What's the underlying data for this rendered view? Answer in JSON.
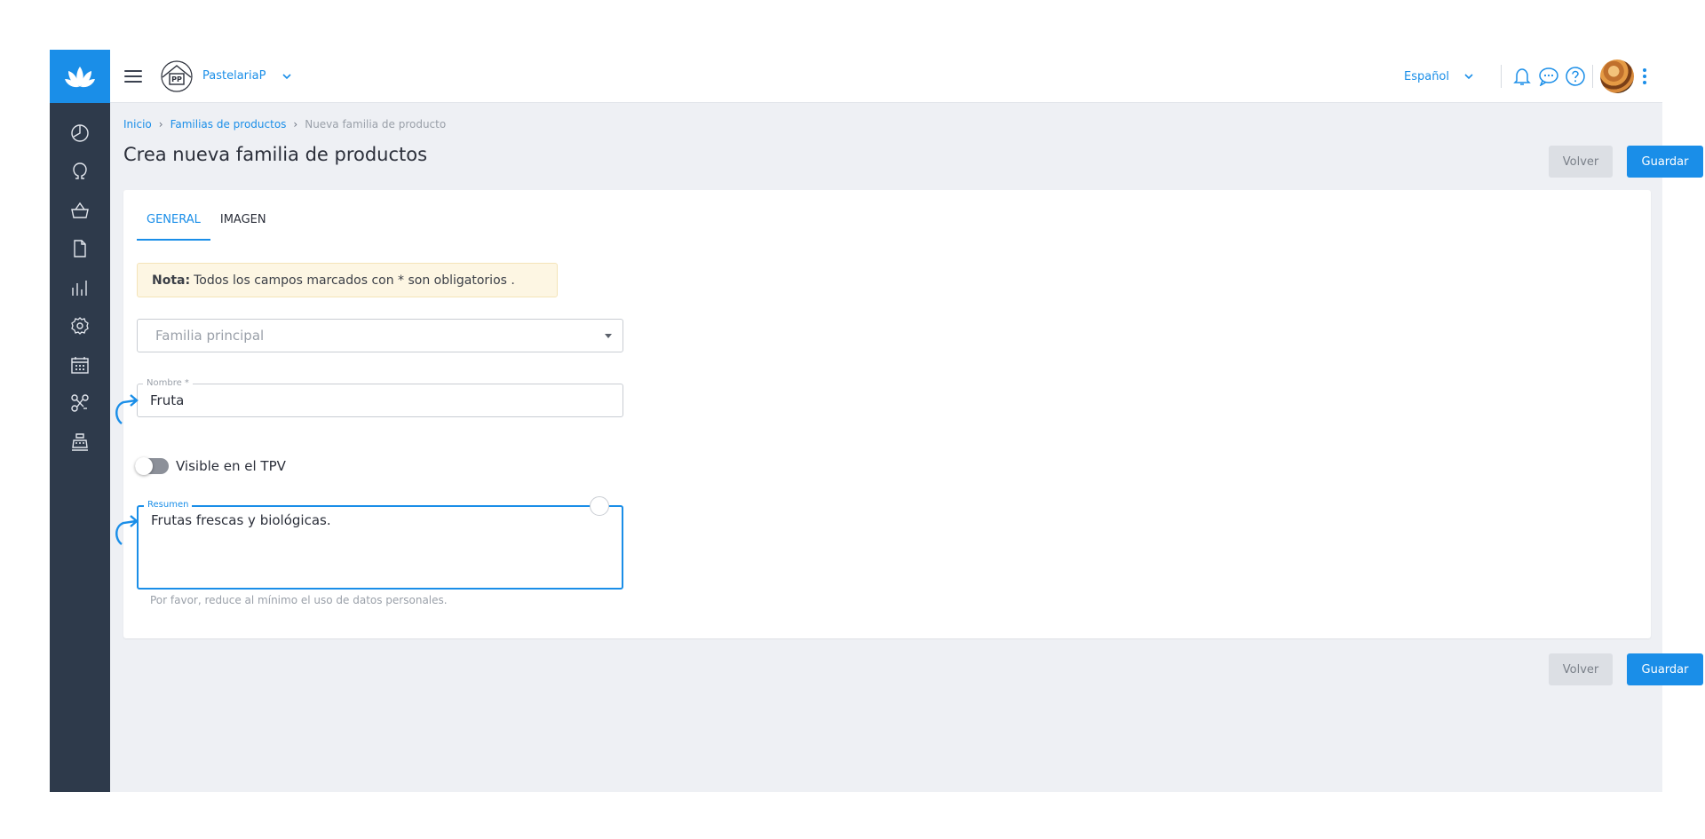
{
  "colors": {
    "accent": "#1a8ee8",
    "sidebar": "#2e3a4b",
    "note_bg": "#fdf6e3"
  },
  "sidebar": {
    "items": [
      {
        "icon": "dashboard-icon"
      },
      {
        "icon": "user-icon"
      },
      {
        "icon": "basket-icon"
      },
      {
        "icon": "document-icon"
      },
      {
        "icon": "stats-icon"
      },
      {
        "icon": "settings-icon"
      },
      {
        "icon": "calendar-icon"
      },
      {
        "icon": "integrations-icon"
      },
      {
        "icon": "register-icon"
      }
    ]
  },
  "header": {
    "store_name": "PastelariaP",
    "language": "Español"
  },
  "breadcrumb": {
    "items": [
      "Inicio",
      "Familias de productos"
    ],
    "current": "Nueva familia de producto"
  },
  "page": {
    "title": "Crea nueva familia de productos",
    "back_label": "Volver",
    "save_label": "Guardar"
  },
  "tabs": [
    {
      "label": "GENERAL",
      "active": true
    },
    {
      "label": "IMAGEN",
      "active": false
    }
  ],
  "note": {
    "bold": "Nota:",
    "text": "Todos los campos marcados con * son obligatorios ."
  },
  "form": {
    "parent_family_placeholder": "Familia principal",
    "name_label": "Nombre *",
    "name_value": "Fruta",
    "visible_label": "Visible en el TPV",
    "visible_on": false,
    "summary_label": "Resumen",
    "summary_value": "Frutas frescas y biológicas.",
    "hint": "Por favor, reduce al mínimo el uso de datos personales."
  }
}
